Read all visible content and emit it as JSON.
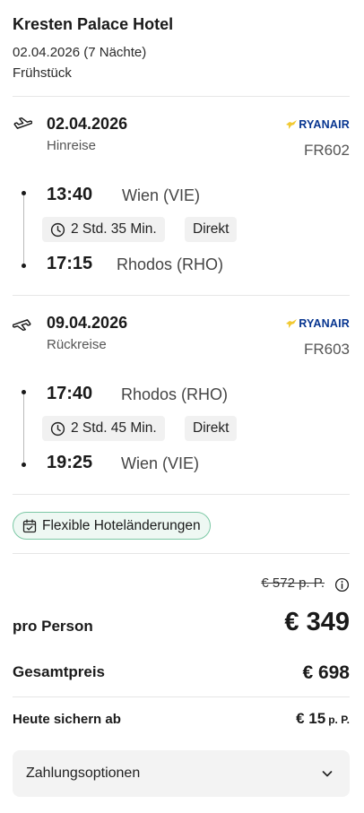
{
  "hotel": {
    "name": "Kresten Palace Hotel",
    "dates": "02.04.2026 (7 Nächte)",
    "board": "Frühstück"
  },
  "outbound": {
    "date": "02.04.2026",
    "type": "Hinreise",
    "airline": "RYANAIR",
    "flight_no": "FR602",
    "departure_time": "13:40",
    "departure_place": "Wien (VIE)",
    "duration": "2 Std. 35 Min.",
    "stops": "Direkt",
    "arrival_time": "17:15",
    "arrival_place": "Rhodos (RHO)"
  },
  "return": {
    "date": "09.04.2026",
    "type": "Rückreise",
    "airline": "RYANAIR",
    "flight_no": "FR603",
    "departure_time": "17:40",
    "departure_place": "Rhodos (RHO)",
    "duration": "2 Std. 45 Min.",
    "stops": "Direkt",
    "arrival_time": "19:25",
    "arrival_place": "Wien (VIE)"
  },
  "badge": {
    "label": "Flexible Hoteländerungen"
  },
  "pricing": {
    "old_price": "€ 572 p. P.",
    "per_person_label": "pro Person",
    "per_person_value": "€ 349",
    "total_label": "Gesamtpreis",
    "total_value": "€ 698",
    "today_label": "Heute sichern ab",
    "today_value": "€ 15",
    "today_suffix": "p. P."
  },
  "payment": {
    "label": "Zahlungsoptionen"
  },
  "colors": {
    "airline": "#073590",
    "badge_border": "#7cc8a5",
    "badge_bg": "#eef8f3"
  },
  "icons": [
    "plane-takeoff-icon",
    "plane-landing-icon",
    "clock-icon",
    "calendar-check-icon",
    "info-icon",
    "chevron-down-icon",
    "ryanair-harp-icon"
  ]
}
